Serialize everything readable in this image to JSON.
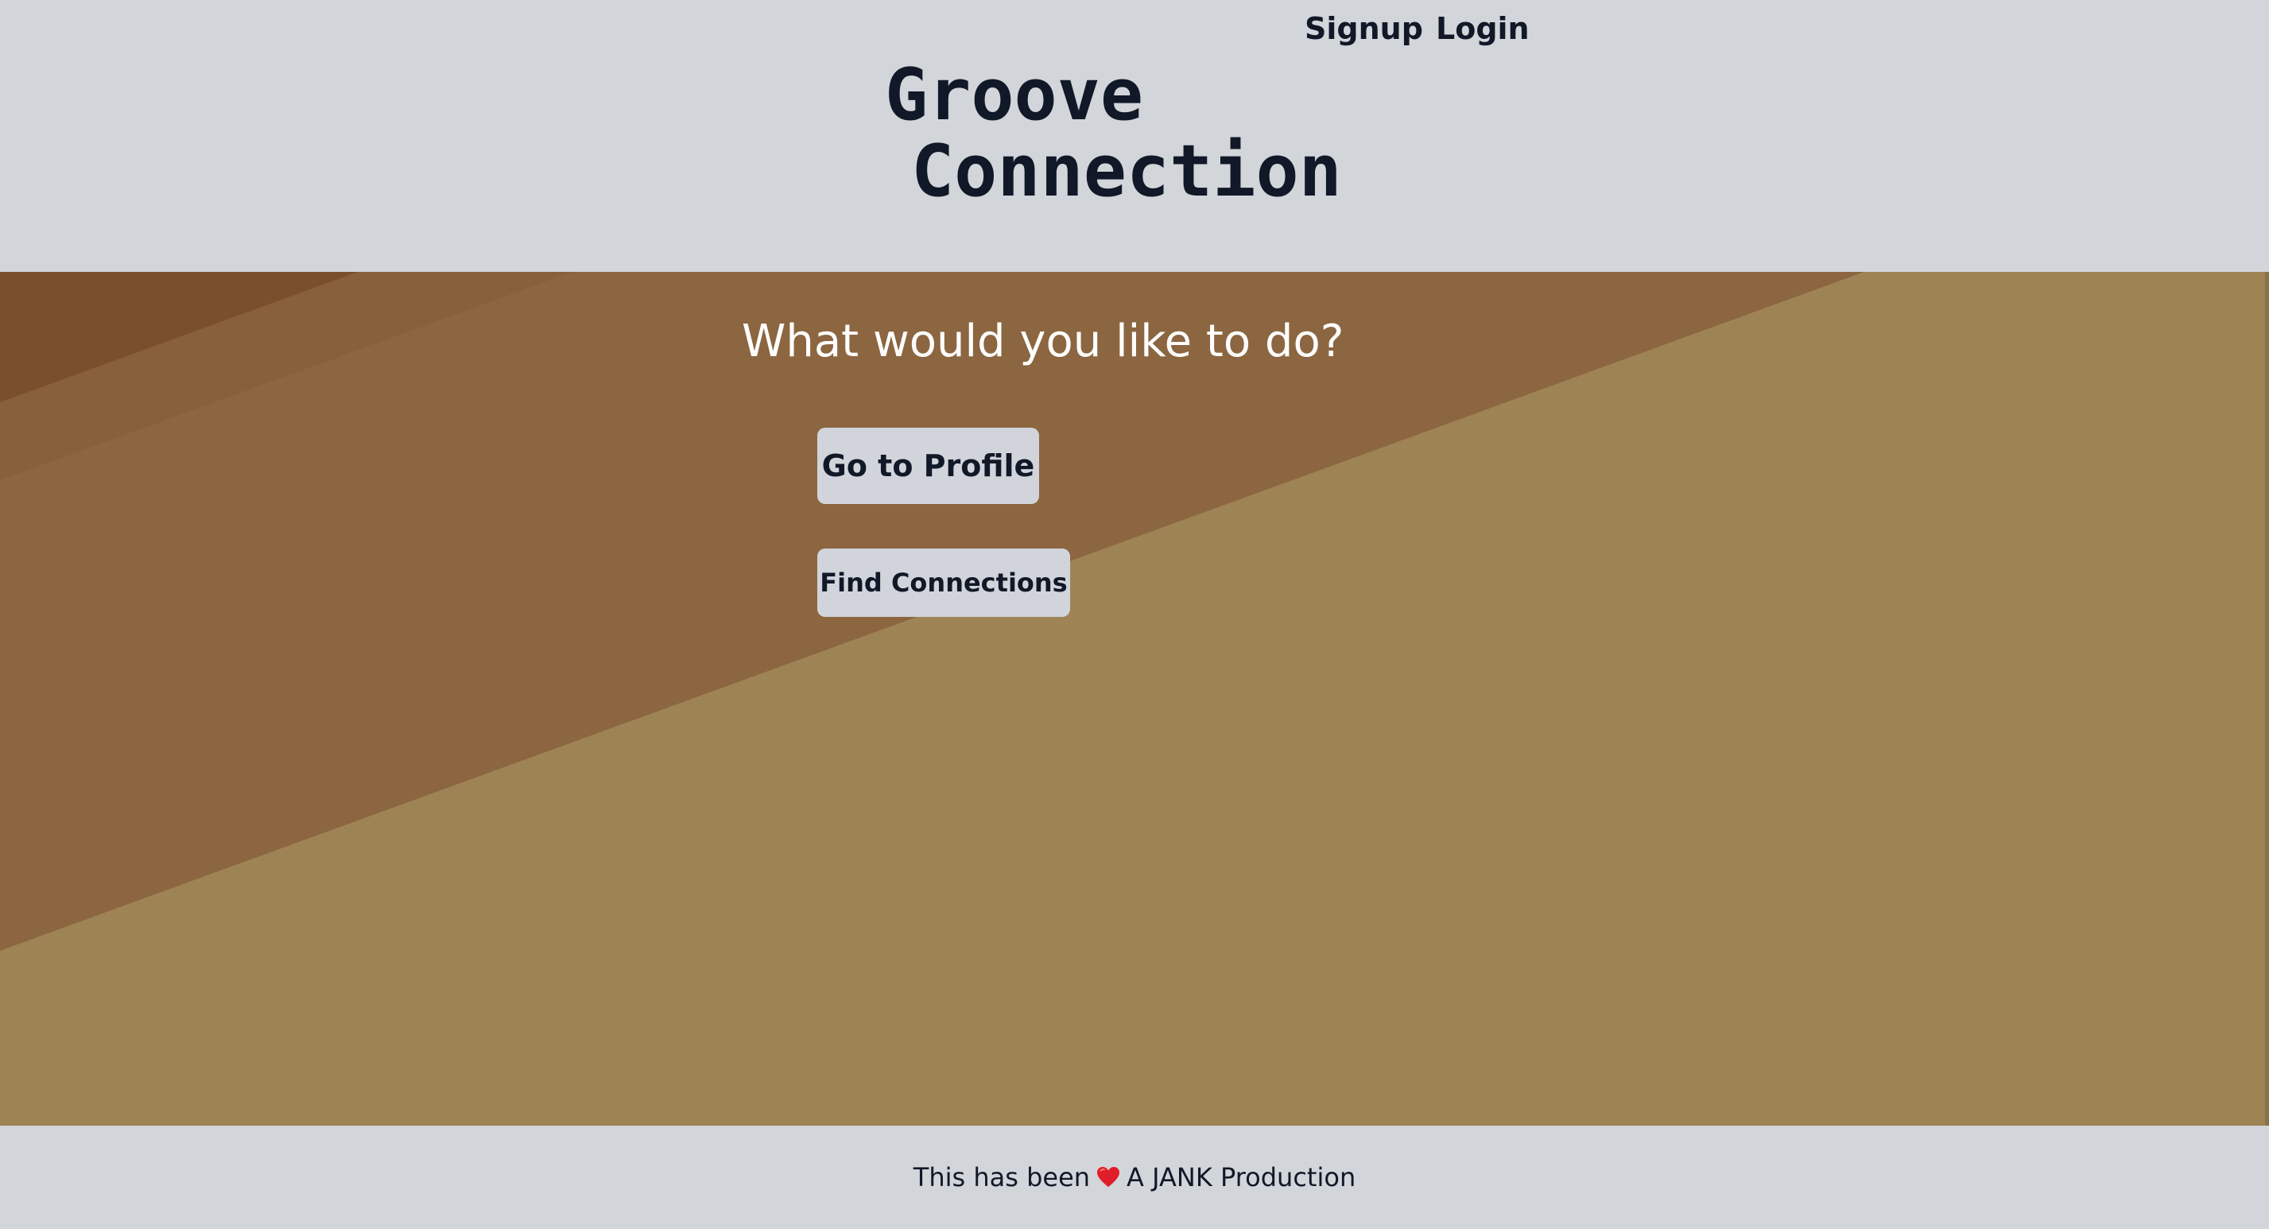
{
  "header": {
    "nav": {
      "signup_label": "Signup",
      "login_label": "Login"
    },
    "title_line1": "Groove",
    "title_line2": "Connection"
  },
  "main": {
    "question": "What would you like to do?",
    "profile_button_label": "Go to Profile",
    "connections_button_label": "Find Connections"
  },
  "footer": {
    "text_before": "This has been",
    "icon": "heart-icon",
    "text_after": "A JANK Production"
  },
  "colors": {
    "header_bg": "#d2d5da",
    "text_dark": "#111827",
    "button_bg": "#d1d5db",
    "band_light": "#9e8454",
    "band_mid": "#8c6640",
    "band_dark": "#7a4f2e",
    "heart": "#e11d2a"
  }
}
